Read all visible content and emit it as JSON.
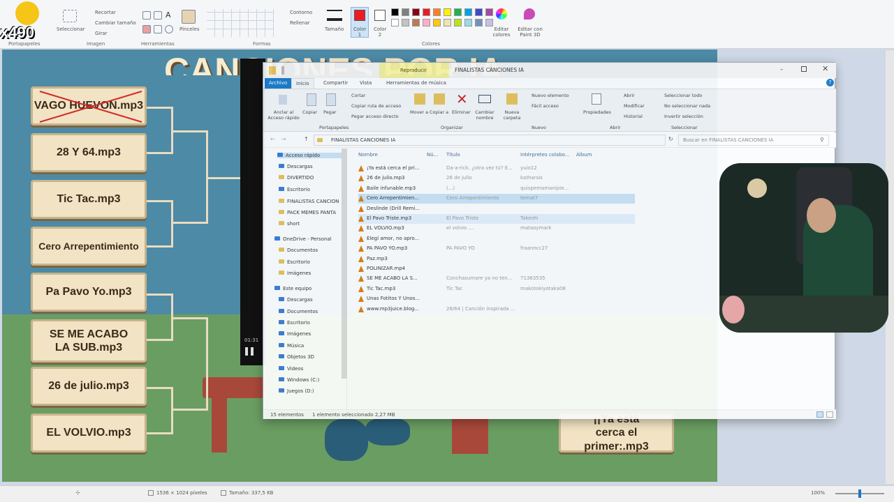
{
  "paint": {
    "overlay_text": "x490",
    "ribbon": {
      "clipboard_group": "Portapapeles",
      "image_group": "Imagen",
      "image_items": [
        "Recortar",
        "Cambiar tamaño",
        "Girar"
      ],
      "select_label": "Seleccionar",
      "tools_group": "Herramientas",
      "brushes_label": "Pinceles",
      "shapes_group": "Formas",
      "contour_label": "Contorno",
      "fill_label": "Rellenar",
      "size_label": "Tamaño",
      "color1_label": "Color 1",
      "color2_label": "Color 2",
      "colors_group": "Colores",
      "edit_colors_label": "Editar colores",
      "paint3d_label": "Editar con Paint 3D",
      "palette": [
        "#000000",
        "#7f7f7f",
        "#880015",
        "#ed1c24",
        "#ff7f27",
        "#fff200",
        "#22b14c",
        "#00a2e8",
        "#3f48cc",
        "#a349a4",
        "#ffffff",
        "#c3c3c3",
        "#b97a57",
        "#ffaec9",
        "#ffc90e",
        "#efe4b0",
        "#b5e61d",
        "#99d9ea",
        "#7092be",
        "#c8bfe7"
      ]
    },
    "status": {
      "dimensions": "1536 × 1024 píxeles",
      "size": "Tamaño: 337,5 KB",
      "zoom": "100%"
    }
  },
  "canvas": {
    "title_fragment": "CANCIONES POR IA",
    "left_songs": [
      "VAGO HUEVON.mp3",
      "28 Y 64.mp3",
      "Tic Tac.mp3",
      "Cero Arrepentimiento",
      "Pa Pavo Yo.mp3",
      "SE ME ACABO LA SUB.mp3",
      "26 de julio.mp3",
      "EL VOLVIO.mp3"
    ],
    "right_song": "¡¡Ya está cerca el primer:.mp3"
  },
  "player": {
    "time": "01:31"
  },
  "explorer": {
    "tool_tab": "Reproducir",
    "title": "FINALISTAS CANCIONES IA",
    "tabs": [
      "Archivo",
      "Inicio",
      "Compartir",
      "Vista",
      "Herramientas de música"
    ],
    "ribbon": {
      "pin_label": "Anclar al Acceso rápido",
      "copy_label": "Copiar",
      "paste_label": "Pegar",
      "cut_label": "Cortar",
      "copy_path_label": "Copiar ruta de acceso",
      "paste_shortcut_label": "Pegar acceso directo",
      "clipboard_group": "Portapapeles",
      "move_label": "Mover a",
      "copy_to_label": "Copiar a",
      "delete_label": "Eliminar",
      "rename_label": "Cambiar nombre",
      "organize_group": "Organizar",
      "new_folder_label": "Nueva carpeta",
      "new_item_label": "Nuevo elemento",
      "easy_access_label": "Fácil acceso",
      "new_group": "Nuevo",
      "properties_label": "Propiedades",
      "open_label": "Abrir",
      "modify_label": "Modificar",
      "history_label": "Historial",
      "open_group": "Abrir",
      "select_all_label": "Seleccionar todo",
      "select_none_label": "No seleccionar nada",
      "invert_label": "Invertir selección",
      "select_group": "Seleccionar"
    },
    "path": "FINALISTAS CANCIONES IA",
    "search_placeholder": "Buscar en FINALISTAS CANCIONES IA",
    "nav": [
      {
        "label": "Acceso rápido",
        "type": "star"
      },
      {
        "label": "Descargas",
        "type": "down"
      },
      {
        "label": "DIVERTIDO",
        "type": "folder"
      },
      {
        "label": "Escritorio",
        "type": "desk"
      },
      {
        "label": "FINALISTAS CANCION",
        "type": "folder"
      },
      {
        "label": "PACK MEMES PANTA",
        "type": "folder"
      },
      {
        "label": "short",
        "type": "folder"
      },
      {
        "label": "OneDrive - Personal",
        "type": "cloud"
      },
      {
        "label": "Documentos",
        "type": "folder"
      },
      {
        "label": "Escritorio",
        "type": "folder"
      },
      {
        "label": "Imágenes",
        "type": "folder"
      },
      {
        "label": "Este equipo",
        "type": "pc"
      },
      {
        "label": "Descargas",
        "type": "down"
      },
      {
        "label": "Documentos",
        "type": "doc"
      },
      {
        "label": "Escritorio",
        "type": "desk"
      },
      {
        "label": "Imágenes",
        "type": "img"
      },
      {
        "label": "Música",
        "type": "music"
      },
      {
        "label": "Objetos 3D",
        "type": "obj"
      },
      {
        "label": "Videos",
        "type": "vid"
      },
      {
        "label": "Windows (C:)",
        "type": "disk"
      },
      {
        "label": "Juegos (D:)",
        "type": "disk"
      }
    ],
    "columns": [
      "Nombre",
      "Nú...",
      "Título",
      "Intérpretes colabo...",
      "Álbum"
    ],
    "files": [
      {
        "name": "¡Ya está cerca el pri...",
        "title": "Da-a-rick. ¿otra vez tú? E...",
        "artist": "yuio12"
      },
      {
        "name": "26 de julio.mp3",
        "title": "26 de julio",
        "artist": "katharsis"
      },
      {
        "name": "Baile infunable.mp3",
        "title": "(...)",
        "artist": "quispemamanipie..."
      },
      {
        "name": "Cero Arrepentimien...",
        "title": "Cero Arrepentimiento",
        "artist": "temat7"
      },
      {
        "name": "Deslinde (Drill Remi...",
        "title": "",
        "artist": ""
      },
      {
        "name": "El Pavo Triste.mp3",
        "title": "El Pavo Triste",
        "artist": "Takeshi"
      },
      {
        "name": "EL VOLVIO.mp3",
        "title": "el volvio ....",
        "artist": "mataoymark"
      },
      {
        "name": "Elegí amor, no apro...",
        "title": "",
        "artist": ""
      },
      {
        "name": "PA PAVO YO.mp3",
        "title": "PA PAVO YO",
        "artist": "fraanncc27"
      },
      {
        "name": "Paz.mp3",
        "title": "",
        "artist": ""
      },
      {
        "name": "POLINIZAR.mp4",
        "title": "",
        "artist": ""
      },
      {
        "name": "SE ME ACABO LA S...",
        "title": "Conchasumare ya no ten...",
        "artist": "71363535"
      },
      {
        "name": "Tic Tac.mp3",
        "title": "Tic Tac",
        "artist": "makotokiyotaka08"
      },
      {
        "name": "Unas Fotitos Y Unos...",
        "title": "",
        "artist": ""
      },
      {
        "name": "www.mp3juice.blog...",
        "title": "28/64 | Canción inspirada ...",
        "artist": ""
      }
    ],
    "status_count": "15 elementos",
    "status_selected": "1 elemento seleccionado  2,27 MB"
  },
  "colors": {
    "selection": "#cce4f7",
    "hover": "#e5f1fb",
    "accent": "#1979ca"
  }
}
